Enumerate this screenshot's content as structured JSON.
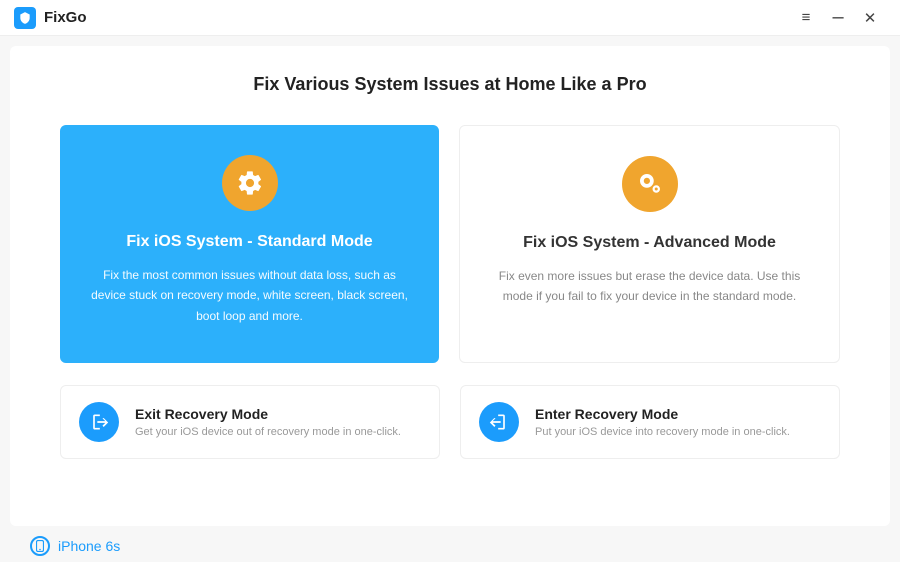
{
  "app": {
    "name": "FixGo"
  },
  "headline": "Fix Various System Issues at Home Like a Pro",
  "cards": {
    "standard": {
      "title": "Fix iOS System - Standard Mode",
      "desc": "Fix the most common issues without data loss, such as device stuck on recovery mode, white screen, black screen, boot loop and more."
    },
    "advanced": {
      "title": "Fix iOS System - Advanced Mode",
      "desc": "Fix even more issues but erase the device data. Use this mode if you fail to fix your device in the standard mode."
    }
  },
  "tiles": {
    "exit": {
      "title": "Exit Recovery Mode",
      "desc": "Get your iOS device out of recovery mode in one-click."
    },
    "enter": {
      "title": "Enter Recovery Mode",
      "desc": "Put your iOS device into recovery mode in one-click."
    }
  },
  "device": {
    "name": "iPhone 6s"
  }
}
